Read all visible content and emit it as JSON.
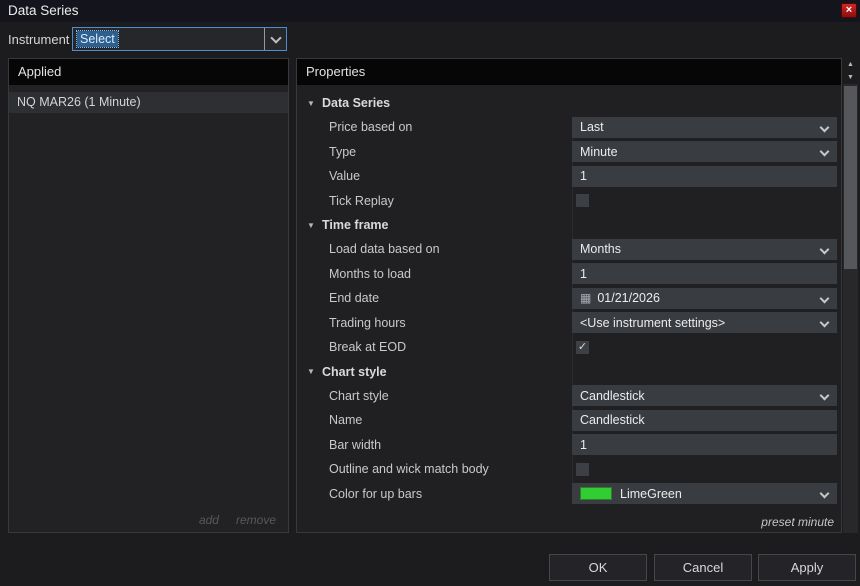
{
  "window": {
    "title": "Data Series"
  },
  "icons": {
    "close": "×",
    "triangle_down": "▼",
    "scroll_up": "▲",
    "scroll_down": "▼",
    "check": "✓",
    "calendar": "▦"
  },
  "colors": {
    "accent_blue": "#4d8ed0",
    "selection_blue": "#2d608f",
    "lime_green": "#32CD32",
    "close_red": "#b41a1a"
  },
  "instrument": {
    "label": "Instrument",
    "value": "Select"
  },
  "applied_panel": {
    "header": "Applied",
    "items": [
      "NQ MAR26 (1 Minute)"
    ],
    "add_label": "add",
    "remove_label": "remove"
  },
  "properties_panel": {
    "header": "Properties",
    "preset_label": "preset minute",
    "rows": [
      {
        "kind": "group",
        "label": "Data Series"
      },
      {
        "kind": "dropdown",
        "label": "Price based on",
        "value": "Last"
      },
      {
        "kind": "dropdown",
        "label": "Type",
        "value": "Minute"
      },
      {
        "kind": "input",
        "label": "Value",
        "value": "1"
      },
      {
        "kind": "checkbox",
        "label": "Tick Replay",
        "checked": false
      },
      {
        "kind": "group",
        "label": "Time frame"
      },
      {
        "kind": "dropdown",
        "label": "Load data based on",
        "value": "Months"
      },
      {
        "kind": "input",
        "label": "Months to load",
        "value": "1"
      },
      {
        "kind": "dropdown",
        "label": "End date",
        "value": "01/21/2026",
        "icon": "calendar"
      },
      {
        "kind": "dropdown",
        "label": "Trading hours",
        "value": "<Use instrument settings>"
      },
      {
        "kind": "checkbox",
        "label": "Break at EOD",
        "checked": true
      },
      {
        "kind": "group",
        "label": "Chart style"
      },
      {
        "kind": "dropdown",
        "label": "Chart style",
        "value": "Candlestick"
      },
      {
        "kind": "input",
        "label": "Name",
        "value": "Candlestick"
      },
      {
        "kind": "input",
        "label": "Bar width",
        "value": "1"
      },
      {
        "kind": "checkbox",
        "label": "Outline and wick match body",
        "checked": false
      },
      {
        "kind": "dropdown",
        "label": "Color for up bars",
        "value": "LimeGreen",
        "swatch": "#32CD32"
      }
    ]
  },
  "footer": {
    "ok": "OK",
    "cancel": "Cancel",
    "apply": "Apply"
  }
}
